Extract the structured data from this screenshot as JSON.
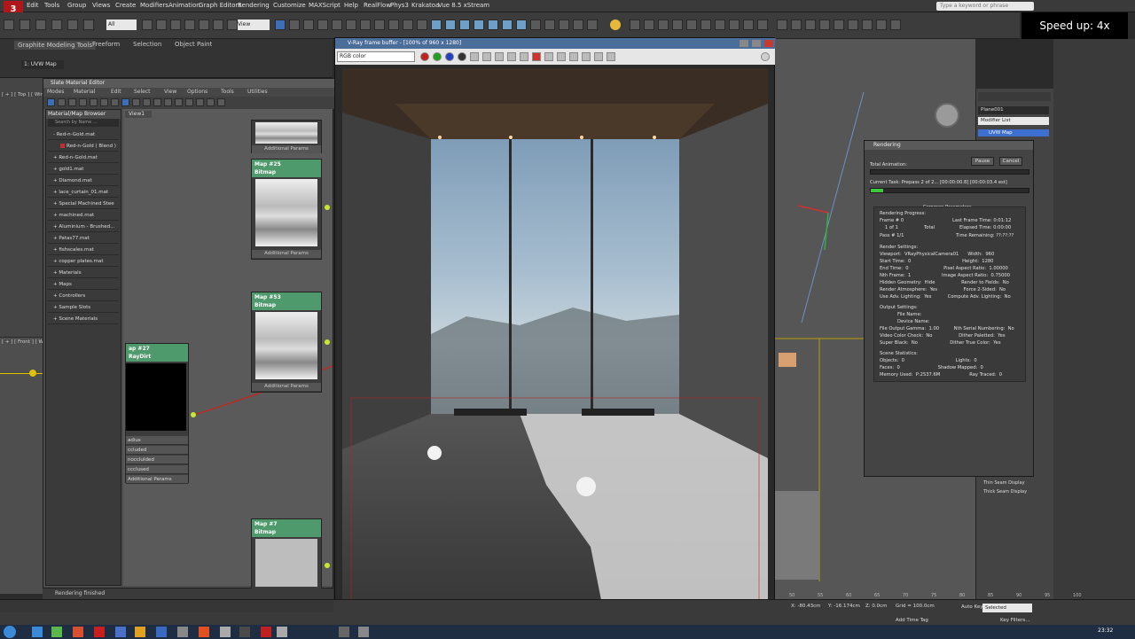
{
  "overlay": {
    "speed_label": "Speed up: 4x"
  },
  "menubar": {
    "items": [
      "Edit",
      "Tools",
      "Group",
      "Views",
      "Create",
      "Modifiers",
      "Animation",
      "Graph Editors",
      "Rendering",
      "Customize",
      "MAXScript",
      "Help",
      "RealFlow",
      "Phys3",
      "Krakatoa",
      "Vue 8.5 xStream"
    ],
    "search_placeholder": "Type a keyword or phrase"
  },
  "toolbar": {
    "selection_set": "All",
    "view_mode": "View"
  },
  "ribbon": {
    "title": "Graphite Modeling Tools",
    "tabs": [
      "Freeform",
      "Selection",
      "Object Paint"
    ],
    "modifier": "1: UVW Map"
  },
  "viewport_labels": {
    "top": "[ + ] [ Top ] [ Wir",
    "front": "[ + ] [ Front ] [ Wir"
  },
  "slate": {
    "title": "Slate Material Editor",
    "menu": [
      "Modes",
      "Material",
      "Edit",
      "Select",
      "View",
      "Options",
      "Tools",
      "Utilities"
    ],
    "browser_title": "Material/Map Browser",
    "search_placeholder": "Search by Name ...",
    "view_tab": "View1",
    "materials": [
      {
        "label": "- Red-n-Gold.mat",
        "sub": false,
        "swatch": false
      },
      {
        "label": "Red-n-Gold  ( Blend )",
        "sub": true,
        "swatch": true
      },
      {
        "label": "+ Red-n-Gold.mat",
        "sub": false,
        "swatch": false
      },
      {
        "label": "+ gold1.mat",
        "sub": false,
        "swatch": false
      },
      {
        "label": "+ Diamond.mat",
        "sub": false,
        "swatch": false
      },
      {
        "label": "+ lace_curtain_01.mat",
        "sub": false,
        "swatch": false
      },
      {
        "label": "+ Special Machined Stee",
        "sub": false,
        "swatch": false
      },
      {
        "label": "+ machined.mat",
        "sub": false,
        "swatch": false
      },
      {
        "label": "+ Aluminium - Brushed...",
        "sub": false,
        "swatch": false
      },
      {
        "label": "+ Patas77.mat",
        "sub": false,
        "swatch": false
      },
      {
        "label": "+ fishscales.mat",
        "sub": false,
        "swatch": false
      },
      {
        "label": "+ copper plates.mat",
        "sub": false,
        "swatch": false
      },
      {
        "label": "+ Materials",
        "sub": false,
        "swatch": false
      },
      {
        "label": "+ Maps",
        "sub": false,
        "swatch": false
      },
      {
        "label": "+ Controllers",
        "sub": false,
        "swatch": false
      },
      {
        "label": "+ Sample Slots",
        "sub": false,
        "swatch": false
      },
      {
        "label": "+ Scene Materials",
        "sub": false,
        "swatch": false
      }
    ],
    "nodes": {
      "top_footer": "Additional Params",
      "map25": {
        "line1": "Map #25",
        "line2": "Bitmap",
        "footer": "Additional Params"
      },
      "map53": {
        "line1": "Map #53",
        "line2": "Bitmap",
        "footer": "Additional Params"
      },
      "map7": {
        "line1": "Map #7",
        "line2": "Bitmap"
      },
      "map27": {
        "line1": "ap #27",
        "line2": "RayDirt",
        "params": [
          "adius",
          "ccluded",
          "nocclulded",
          "ccclused",
          "Additional Params"
        ]
      }
    },
    "status": "Rendering finished"
  },
  "vfb": {
    "title": "V-Ray frame buffer - [100% of 960 x 1280]",
    "channel": "RGB color"
  },
  "command_panel": {
    "object_name": "Plane001",
    "modifier_list": "Modifier List",
    "stack_item": "UVW Map",
    "seam_options": [
      "Thin Seam Display",
      "Thick Seam Display"
    ]
  },
  "rendering_dialog": {
    "title": "Rendering",
    "buttons": {
      "pause": "Pause",
      "cancel": "Cancel"
    },
    "total_label": "Total Animation:",
    "current_task": "Current Task:   Prepass 2 of 2... [00:00:00.8] [00:00:03.4 est]",
    "progress": 0.08,
    "section_title": "Common Parameters",
    "progress_title": "Rendering Progress:",
    "frame_hash": "Frame #  0",
    "frame_of": "1 of 1",
    "total_word": "Total",
    "pass_hash": "Pass #  1/1",
    "last_frame_time": "Last Frame Time:  0:01:12",
    "elapsed": "Elapsed Time:  0:00:00",
    "remaining": "Time Remaining:  ??:??:??",
    "settings_title": "Render Settings:",
    "settings": [
      "Viewport:  VRayPhysicalCamera01      Width:  960",
      "Start Time:  0                                   Height:  1280",
      "End Time:  0                        Pixel Aspect Ratio:  1.00000",
      "Nth Frame:  1                     Image Aspect Ratio:  0.75000",
      "Hidden Geometry:  Hide                  Render to Fields:  No",
      "Render Atmosphere:  Yes                  Force 2-Sided:  No",
      "Use Adv. Lighting:  Yes           Compute Adv. Lighting:  No"
    ],
    "output_title": "Output Settings:",
    "output": [
      "File Name:",
      "Device Name:",
      "File Output Gamma:  1.00          Nth Serial Numbering:  No",
      "Video Color Check:  No                  Dither Paletted:  Yes",
      "Super Black:  No                      Dither True Color:  Yes"
    ],
    "scene_title": "Scene Statistics:",
    "scene": [
      "Objects:  0                                   Lights:  0",
      "Faces:  0                          Shadow Mapped:  0",
      "Memory Used:  P:2537.6M                    Ray Traced:  0"
    ]
  },
  "bottom": {
    "x": "X: -80.43cm",
    "y": "Y: -16.174cm",
    "z": "Z: 0.0cm",
    "grid": "Grid = 100.0cm",
    "autokey": "Auto Key",
    "selected": "Selected",
    "add_time_tag": "Add Time Tag",
    "key_filters": "Key Filters...",
    "clock": "23:32",
    "timeline_ticks": [
      "50",
      "55",
      "60",
      "65",
      "70",
      "75",
      "80",
      "85",
      "90",
      "95",
      "100"
    ]
  },
  "colors": {
    "accent_blue": "#3d6fb8",
    "node_green": "#4f9a6c",
    "render_logo": "#b0161a"
  }
}
